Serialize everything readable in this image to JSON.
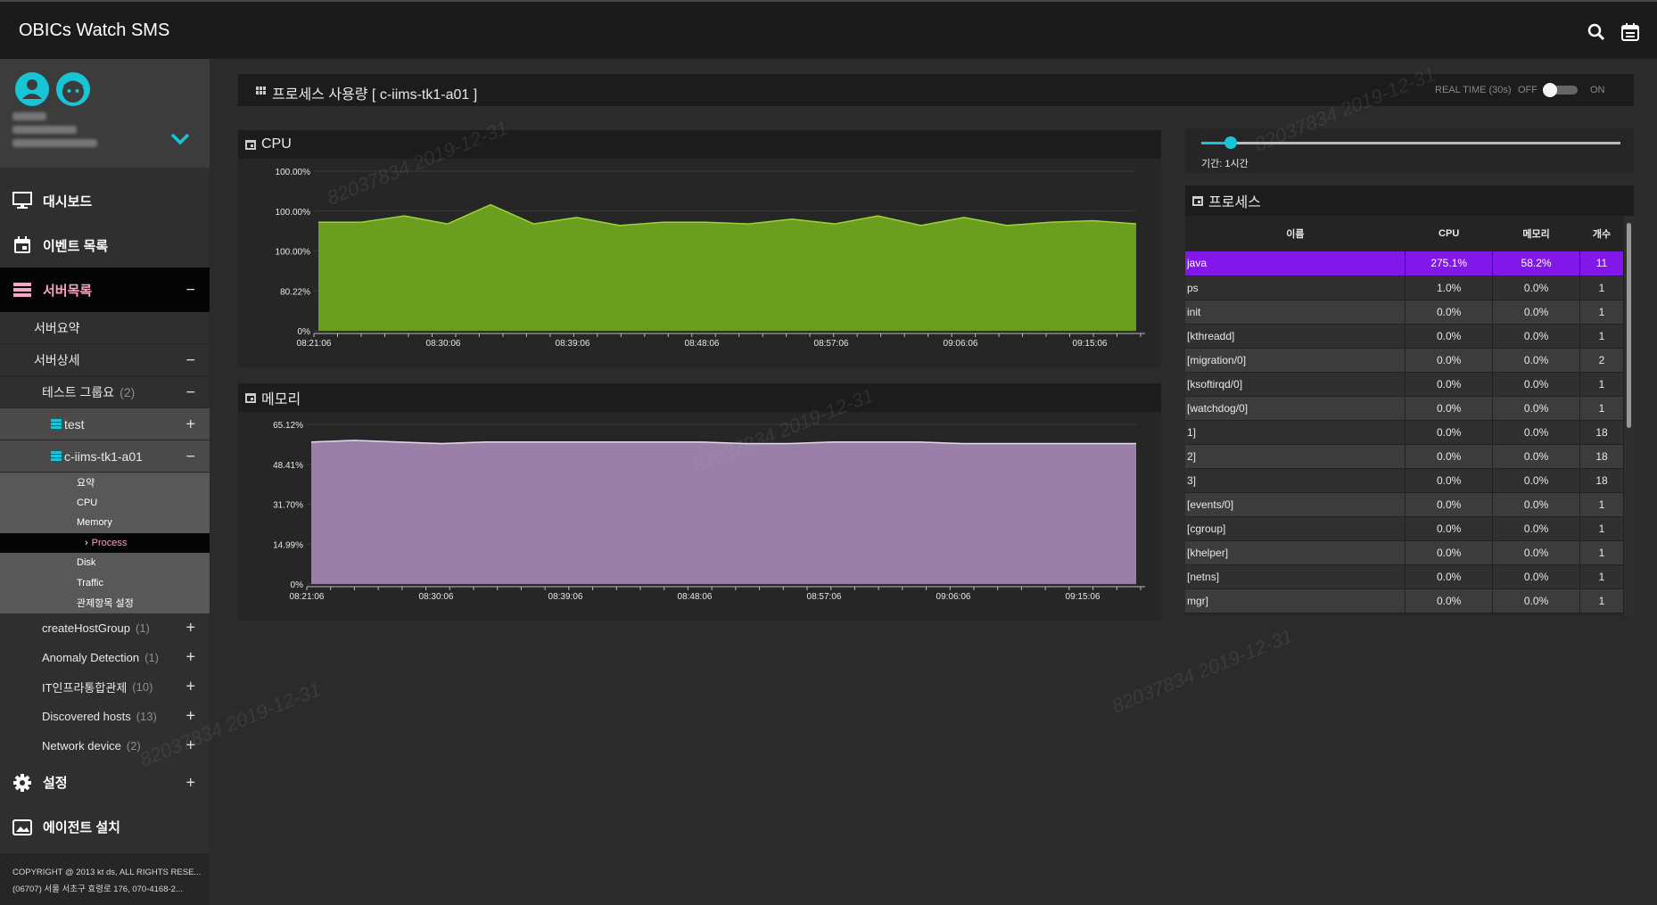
{
  "app": {
    "title": "OBICs Watch SMS"
  },
  "icons": {
    "search": "search-icon",
    "calendar": "calendar-icon",
    "accent": "#18c5d6"
  },
  "sidebar": {
    "dashboard": "대시보드",
    "events": "이벤트 목록",
    "servers": "서버목록",
    "server_summary": "서버요약",
    "server_detail": "서버상세",
    "test_group": {
      "label": "테스트 그룹요",
      "count": "(2)"
    },
    "test": "test",
    "host": "c-iims-tk1-a01",
    "host_items": [
      "요약",
      "CPU",
      "Memory",
      "Process",
      "Disk",
      "Traffic",
      "관제항목 설정"
    ],
    "groups": [
      {
        "label": "createHostGroup",
        "count": "(1)"
      },
      {
        "label": "Anomaly Detection",
        "count": "(1)"
      },
      {
        "label": "IT인프라통합관제",
        "count": "(10)"
      },
      {
        "label": "Discovered hosts",
        "count": "(13)"
      },
      {
        "label": "Network device",
        "count": "(2)"
      }
    ],
    "settings": "설정",
    "agent_install": "에이전트 설치",
    "footer_line1": "COPYRIGHT @ 2013 kt ds, ALL RIGHTS RESE...",
    "footer_line2": "(06707) 서울 서초구 효령로 176, 070-4168-2..."
  },
  "main": {
    "title": "프로세스 사용량 [ c-iims-tk1-a01 ]",
    "realtime_label": "REAL TIME (30s)",
    "off": "OFF",
    "on": "ON",
    "realtime_on": false
  },
  "slider": {
    "period_label": "기간: 1시간",
    "value_fraction": 0.07
  },
  "cpu": {
    "title": "CPU",
    "y_ticks": [
      "100.00%",
      "100.00%",
      "100.00%",
      "80.22%",
      "0%"
    ],
    "x_ticks": [
      "08:21:06",
      "08:30:06",
      "08:39:06",
      "08:48:06",
      "08:57:06",
      "09:06:06",
      "09:15:06"
    ],
    "color": "#6b9e1f",
    "line_color": "#9bd438"
  },
  "memory": {
    "title": "메모리",
    "y_ticks": [
      "65.12%",
      "48.41%",
      "31.70%",
      "14.99%",
      "0%"
    ],
    "x_ticks": [
      "08:21:06",
      "08:30:06",
      "08:39:06",
      "08:48:06",
      "08:57:06",
      "09:06:06",
      "09:15:06"
    ],
    "color": "#9a80a8",
    "line_color": "#e7dbef"
  },
  "processes": {
    "title": "프로세스",
    "columns": [
      "이름",
      "CPU",
      "메모리",
      "개수"
    ],
    "rows": [
      [
        "java",
        "275.1%",
        "58.2%",
        "11"
      ],
      [
        "ps",
        "1.0%",
        "0.0%",
        "1"
      ],
      [
        "init",
        "0.0%",
        "0.0%",
        "1"
      ],
      [
        "[kthreadd]",
        "0.0%",
        "0.0%",
        "1"
      ],
      [
        "[migration/0]",
        "0.0%",
        "0.0%",
        "2"
      ],
      [
        "[ksoftirqd/0]",
        "0.0%",
        "0.0%",
        "1"
      ],
      [
        "[watchdog/0]",
        "0.0%",
        "0.0%",
        "1"
      ],
      [
        "1]",
        "0.0%",
        "0.0%",
        "18"
      ],
      [
        "2]",
        "0.0%",
        "0.0%",
        "18"
      ],
      [
        "3]",
        "0.0%",
        "0.0%",
        "18"
      ],
      [
        "[events/0]",
        "0.0%",
        "0.0%",
        "1"
      ],
      [
        "[cgroup]",
        "0.0%",
        "0.0%",
        "1"
      ],
      [
        "[khelper]",
        "0.0%",
        "0.0%",
        "1"
      ],
      [
        "[netns]",
        "0.0%",
        "0.0%",
        "1"
      ],
      [
        "mgr]",
        "0.0%",
        "0.0%",
        "1"
      ]
    ]
  }
}
